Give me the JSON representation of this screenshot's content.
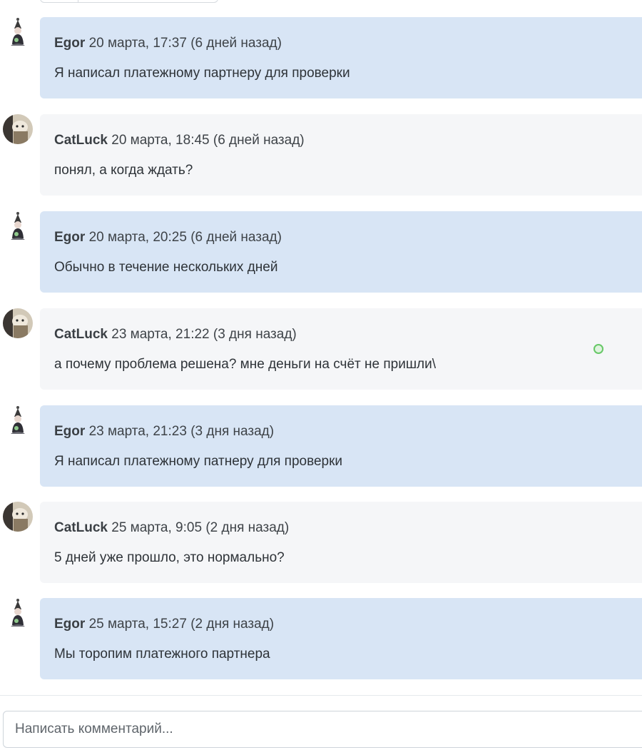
{
  "comments": [
    {
      "role": "staff",
      "author": "Egor",
      "time": "20 марта, 17:37 (6 дней назад)",
      "text": "Я написал платежному партнеру для проверки"
    },
    {
      "role": "user",
      "author": "CatLuck",
      "time": "20 марта, 18:45 (6 дней назад)",
      "text": "понял, а когда ждать?"
    },
    {
      "role": "staff",
      "author": "Egor",
      "time": "20 марта, 20:25 (6 дней назад)",
      "text": "Обычно в течение нескольких дней"
    },
    {
      "role": "user",
      "author": "CatLuck",
      "time": "23 марта, 21:22 (3 дня назад)",
      "text": "а почему проблема решена? мне деньги на счёт не пришли\\",
      "status_indicator": true
    },
    {
      "role": "staff",
      "author": "Egor",
      "time": "23 марта, 21:23 (3 дня назад)",
      "text": "Я написал платежному патнеру для проверки"
    },
    {
      "role": "user",
      "author": "CatLuck",
      "time": "25 марта, 9:05 (2 дня назад)",
      "text": "5 дней уже прошло, это нормально?"
    },
    {
      "role": "staff",
      "author": "Egor",
      "time": "25 марта, 15:27 (2 дня назад)",
      "text": "Мы торопим платежного партнера"
    }
  ],
  "comment_input": {
    "placeholder": "Написать комментарий...",
    "value": ""
  },
  "colors": {
    "staff_bubble": "#d8e5f5",
    "user_bubble": "#f5f6f8",
    "status_dot": "#67c867"
  },
  "icons": {
    "staff_avatar": "staff-avatar-icon",
    "user_avatar": "user-avatar-icon"
  }
}
